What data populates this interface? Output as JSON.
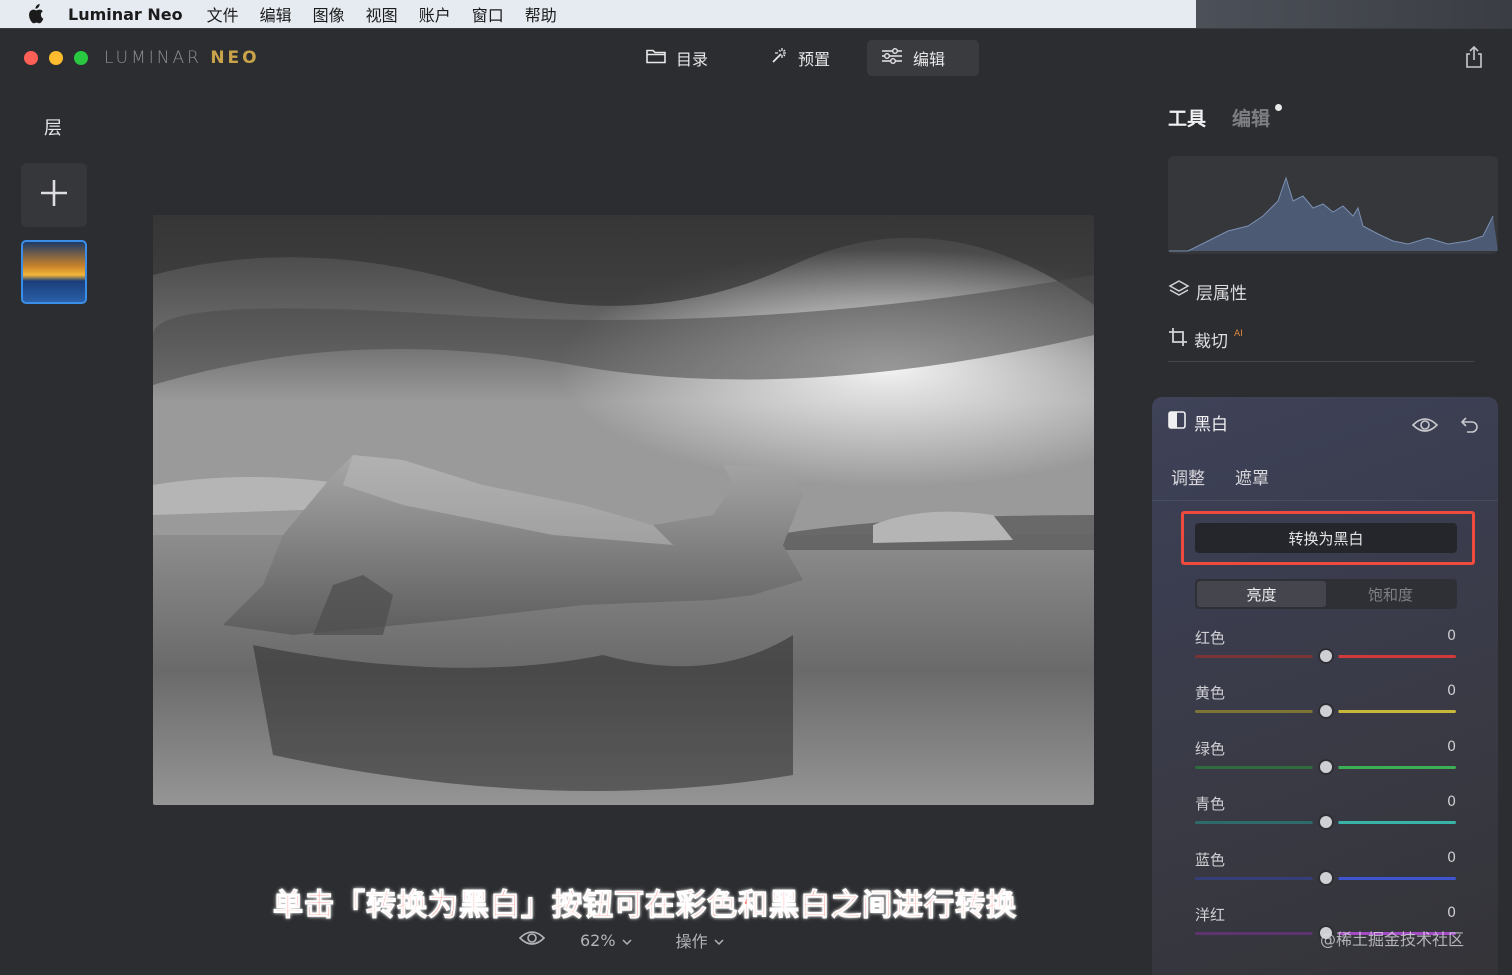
{
  "menubar": {
    "app_name": "Luminar Neo",
    "items": [
      "文件",
      "编辑",
      "图像",
      "视图",
      "账户",
      "窗口",
      "帮助"
    ]
  },
  "titlebar": {
    "logo_main": "LUMINAR ",
    "logo_accent": "NEO",
    "tabs": [
      {
        "label": "目录",
        "icon": "folder-icon"
      },
      {
        "label": "预置",
        "icon": "magic-wand-icon"
      },
      {
        "label": "编辑",
        "icon": "sliders-icon",
        "active": true
      }
    ]
  },
  "left": {
    "layers_title": "层"
  },
  "bottom": {
    "zoom": "62%",
    "actions": "操作"
  },
  "caption": "单击「转换为黑白」按钮可在彩色和黑白之间进行转换",
  "right": {
    "tab_tools": "工具",
    "tab_edits": "编辑",
    "layer_props": "层属性",
    "crop": "裁切",
    "crop_badge": "AI",
    "bw_panel": {
      "title": "黑白",
      "subtabs": [
        "调整",
        "遮罩"
      ],
      "convert_button": "转换为黑白",
      "segment": {
        "active": "亮度",
        "inactive": "饱和度"
      },
      "sliders": [
        {
          "label": "红色",
          "value": "0",
          "color_left": "#7a3434",
          "color_right": "#d13a3a"
        },
        {
          "label": "黄色",
          "value": "0",
          "color_left": "#7c7436",
          "color_right": "#c9b73b"
        },
        {
          "label": "绿色",
          "value": "0",
          "color_left": "#2f6b3b",
          "color_right": "#3cae55"
        },
        {
          "label": "青色",
          "value": "0",
          "color_left": "#2f6a6a",
          "color_right": "#37b3a8"
        },
        {
          "label": "蓝色",
          "value": "0",
          "color_left": "#343f78",
          "color_right": "#3f55cf"
        },
        {
          "label": "洋红",
          "value": "0",
          "color_left": "#5d3470",
          "color_right": "#a34bc3"
        }
      ]
    }
  },
  "watermark": "@稀土掘金技术社区"
}
